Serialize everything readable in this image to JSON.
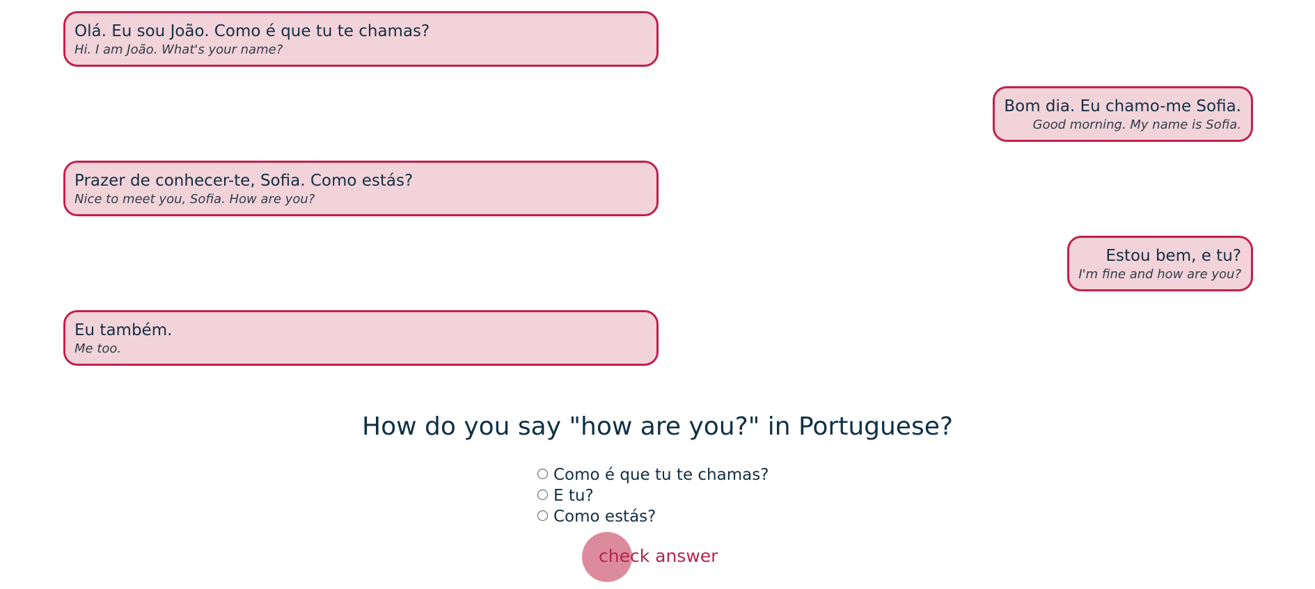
{
  "dialogue": [
    {
      "pt": "Olá. Eu sou João. Como é que tu te chamas?",
      "en": "Hi. I am João. What's your name?"
    },
    {
      "pt": "Bom dia. Eu chamo-me Sofia.",
      "en": "Good morning. My name is Sofia."
    },
    {
      "pt": "Prazer de conhecer-te, Sofia. Como estás?",
      "en": "Nice to meet you, Sofia. How are you?"
    },
    {
      "pt": "Estou bem, e tu?",
      "en": "I'm fine and how are you?"
    },
    {
      "pt": "Eu também.",
      "en": "Me too."
    }
  ],
  "quiz": {
    "question": "How do you say \"how are you?\" in Portuguese?",
    "options": [
      "Como é que tu te chamas?",
      "E tu?",
      "Como estás?"
    ],
    "check_label": "check answer"
  },
  "colors": {
    "bubble_bg": "#f2d3d9",
    "bubble_border": "#c21f4d",
    "text": "#142f43",
    "button_circle": "#dc8b9c",
    "button_text": "#b3264c"
  }
}
